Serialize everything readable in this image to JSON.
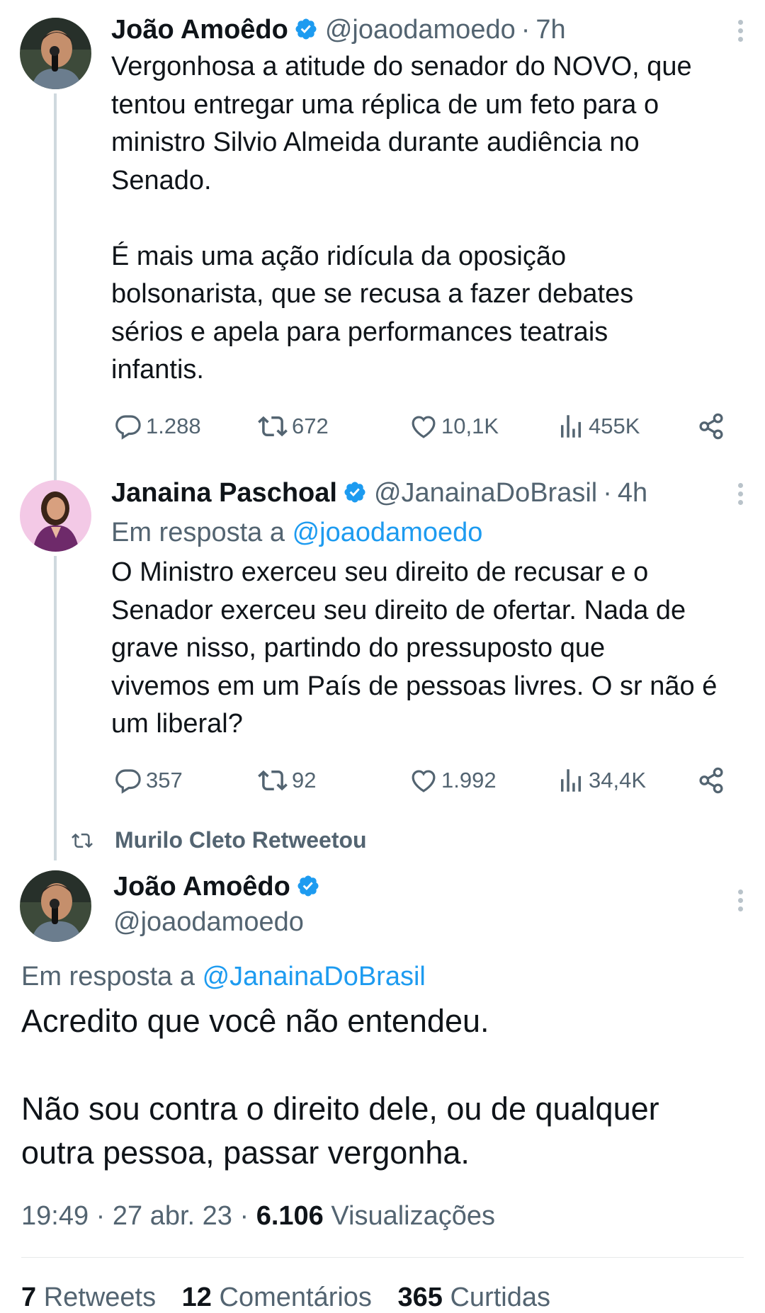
{
  "tweet1": {
    "name": "João Amoêdo",
    "handle": "@joaodamoedo",
    "separator": "·",
    "time": "7h",
    "text": "Vergonhosa a atitude do senador do NOVO, que\ntentou entregar uma réplica de um feto para o\nministro Silvio Almeida durante audiência no\nSenado.\n\nÉ mais uma ação ridícula da oposição\nbolsonarista, que se recusa a fazer debates\nsérios e apela para performances teatrais\ninfantis.",
    "replies": "1.288",
    "retweets": "672",
    "likes": "10,1K",
    "views": "455K"
  },
  "tweet2": {
    "name": "Janaina Paschoal",
    "handle": "@JanainaDoBrasil",
    "separator": "·",
    "time": "4h",
    "reply_prefix": "Em resposta a ",
    "reply_to": "@joaodamoedo",
    "text": "O Ministro exerceu seu direito de recusar e o\nSenador exerceu seu direito de ofertar. Nada de\ngrave nisso, partindo do pressuposto que\nvivemos em um País de pessoas livres. O sr não é\num liberal?",
    "replies": "357",
    "retweets": "92",
    "likes": "1.992",
    "views": "34,4K"
  },
  "retweeted_by": "Murilo Cleto Retweetou",
  "main_tweet": {
    "name": "João Amoêdo",
    "handle": "@joaodamoedo",
    "reply_prefix": "Em resposta a ",
    "reply_to": "@JanainaDoBrasil",
    "text": "Acredito que você não entendeu.\n\nNão sou contra o direito dele, ou de qualquer\noutra pessoa, passar vergonha.",
    "time": "19:49",
    "dot1": "·",
    "date": "27 abr. 23",
    "dot2": "·",
    "views_count": "6.106",
    "views_label": "Visualizações",
    "retweets_count": "7",
    "retweets_label": "Retweets",
    "comments_count": "12",
    "comments_label": "Comentários",
    "likes_count": "365",
    "likes_label": "Curtidas"
  },
  "colors": {
    "accent": "#1d9bf0",
    "secondary_text": "#536471",
    "primary_text": "#0f1419",
    "thread_line": "#cfd9de"
  },
  "icons": [
    "verified-badge-icon",
    "more-options-icon",
    "reply-icon",
    "retweet-icon",
    "like-icon",
    "views-icon",
    "share-icon"
  ]
}
